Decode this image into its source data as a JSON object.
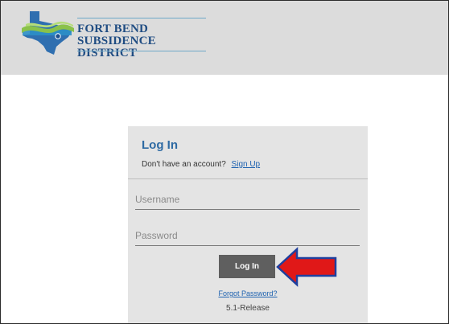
{
  "brand": {
    "line1": "FORT BEND",
    "line2": "SUBSIDENCE DISTRICT"
  },
  "login": {
    "title": "Log In",
    "no_account_text": "Don't have an account?",
    "signup_label": "Sign Up",
    "username_placeholder": "Username",
    "password_placeholder": "Password",
    "button_label": "Log In",
    "forgot_label": "Forgot Password?",
    "version": "5.1-Release"
  },
  "colors": {
    "header_bg": "#dcdcdc",
    "brand_text": "#1f4c82",
    "title": "#2e6aa3",
    "link": "#1e62b0",
    "button_bg": "#5f5f5f",
    "panel_bg": "#e4e4e4",
    "annotation_arrow": "#e01818"
  },
  "icons": {
    "logo": "texas-map-logo-icon",
    "annotation": "red-arrow-icon"
  }
}
